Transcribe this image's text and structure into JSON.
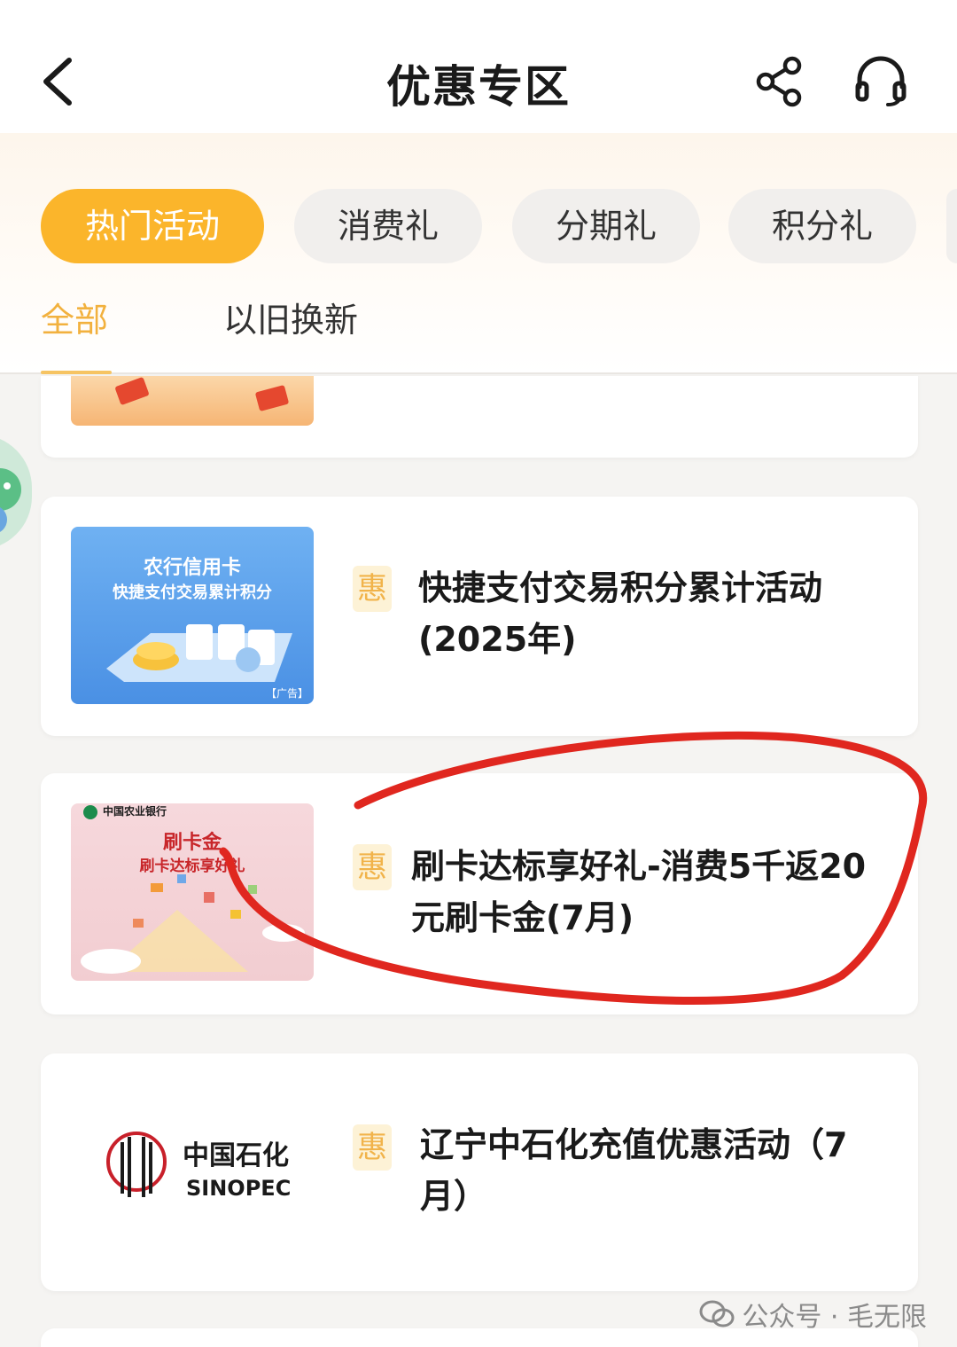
{
  "header": {
    "title": "优惠专区",
    "icons": [
      "back-arrow-icon",
      "share-icon",
      "headset-icon"
    ]
  },
  "categories": {
    "items": [
      {
        "label": "热门活动",
        "active": true
      },
      {
        "label": "消费礼",
        "active": false
      },
      {
        "label": "分期礼",
        "active": false
      },
      {
        "label": "积分礼",
        "active": false
      }
    ]
  },
  "sub_tabs": {
    "items": [
      {
        "label": "全部",
        "active": true
      },
      {
        "label": "以旧换新",
        "active": false
      }
    ]
  },
  "cards": [
    {
      "badge": "惠",
      "title_line1": "快捷支付交易积分累计活动",
      "title_line2": "(2025年)",
      "thumb_title1": "农行信用卡",
      "thumb_title2": "快捷支付交易累计积分",
      "thumb_tag": "【广告】"
    },
    {
      "badge": "惠",
      "title_line1": "刷卡达标享好礼-消费5千返20",
      "title_line2": "元刷卡金(7月)",
      "thumb_bank": "中国农业银行",
      "thumb_title1": "刷卡金",
      "thumb_title2": "刷卡达标享好礼"
    },
    {
      "badge": "惠",
      "title_line1": "辽宁中石化充值优惠活动（7",
      "title_line2": "月）",
      "thumb_cn": "中国石化",
      "thumb_en": "SINOPEC"
    }
  ],
  "watermark": "公众号 · 毛无限",
  "colors": {
    "accent": "#fbb52b",
    "annotation": "#e0271f",
    "badge_bg": "#fdf2d6"
  }
}
